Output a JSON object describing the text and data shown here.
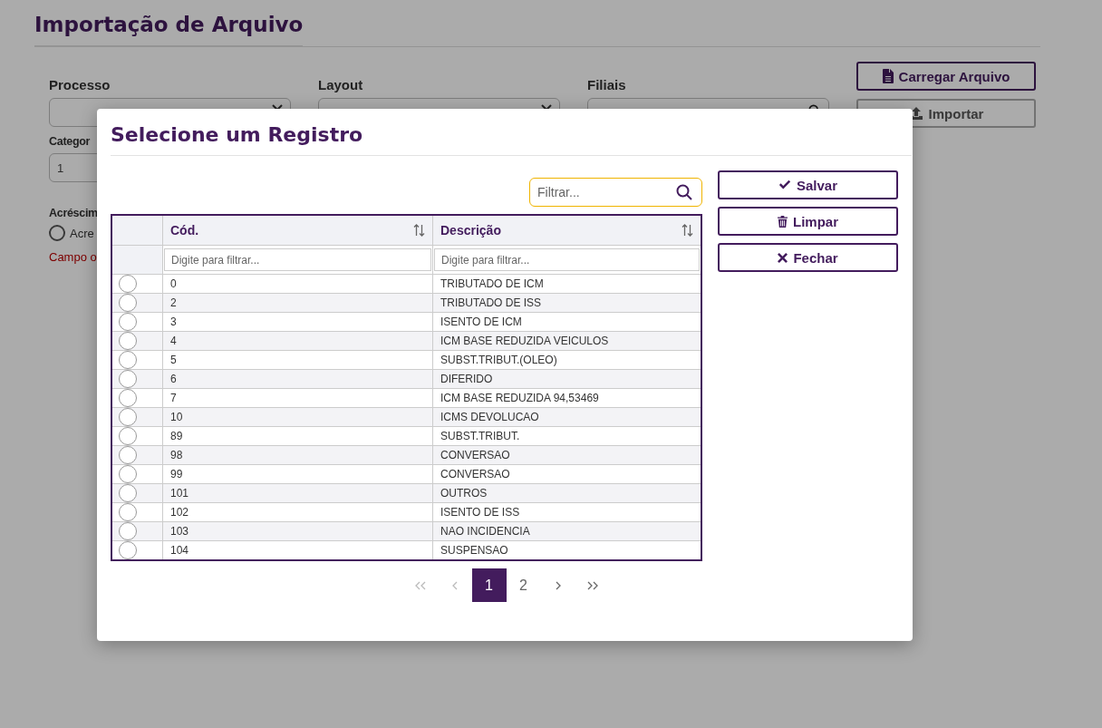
{
  "page": {
    "title": "Importação de Arquivo",
    "fields": [
      {
        "label": "Processo",
        "kind": "select"
      },
      {
        "label": "Layout",
        "kind": "select"
      },
      {
        "label": "Filiais",
        "kind": "search"
      }
    ],
    "buttons": [
      {
        "label": "Carregar Arquivo",
        "kind": "file",
        "disabled": false
      },
      {
        "label": "Importar",
        "kind": "upload",
        "disabled": true
      }
    ],
    "category": {
      "label": "Categor",
      "value": "1"
    },
    "extra": {
      "label": "Acréscim",
      "option": "Acre",
      "selected": false,
      "error": "Campo o"
    }
  },
  "modal": {
    "title": "Selecione um Registro",
    "filter_placeholder": "Filtrar...",
    "columns": [
      {
        "label": "Cód.",
        "filter_placeholder": "Digite para filtrar..."
      },
      {
        "label": "Descrição",
        "filter_placeholder": "Digite para filtrar..."
      }
    ],
    "rows": [
      {
        "code": "0",
        "description": "TRIBUTADO DE ICM",
        "selected": false
      },
      {
        "code": "2",
        "description": "TRIBUTADO DE ISS",
        "selected": false
      },
      {
        "code": "3",
        "description": "ISENTO DE ICM",
        "selected": false
      },
      {
        "code": "4",
        "description": "ICM BASE REDUZIDA VEICULOS",
        "selected": false
      },
      {
        "code": "5",
        "description": "SUBST.TRIBUT.(OLEO)",
        "selected": false
      },
      {
        "code": "6",
        "description": "DIFERIDO",
        "selected": false
      },
      {
        "code": "7",
        "description": "ICM BASE REDUZIDA 94,53469",
        "selected": false
      },
      {
        "code": "10",
        "description": "ICMS DEVOLUCAO",
        "selected": false
      },
      {
        "code": "89",
        "description": "SUBST.TRIBUT.",
        "selected": false
      },
      {
        "code": "98",
        "description": "CONVERSAO",
        "selected": false
      },
      {
        "code": "99",
        "description": "CONVERSAO",
        "selected": false
      },
      {
        "code": "101",
        "description": "OUTROS",
        "selected": false
      },
      {
        "code": "102",
        "description": "ISENTO DE ISS",
        "selected": false
      },
      {
        "code": "103",
        "description": "NAO INCIDENCIA",
        "selected": false
      },
      {
        "code": "104",
        "description": "SUSPENSAO",
        "selected": false
      }
    ],
    "actions": [
      {
        "label": "Salvar",
        "kind": "check"
      },
      {
        "label": "Limpar",
        "kind": "trash"
      },
      {
        "label": "Fechar",
        "kind": "close"
      }
    ],
    "pages": [
      {
        "label": "1",
        "selected": true
      },
      {
        "label": "2",
        "selected": false
      }
    ]
  }
}
